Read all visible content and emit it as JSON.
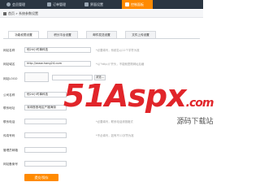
{
  "nav": [
    {
      "label": "会员管理",
      "icon": "user-icon",
      "active": false
    },
    {
      "label": "订单管理",
      "icon": "order-icon",
      "active": false
    },
    {
      "label": "界面设置",
      "icon": "appearance-icon",
      "active": false
    },
    {
      "label": "控制面板",
      "icon": "settings-icon",
      "active": true
    }
  ],
  "breadcrumb": {
    "home": "首页",
    "separator": "»",
    "current": "系统参数设置"
  },
  "tabs": [
    "功能权限设置",
    "积分平台设置",
    "邮件发送设置",
    "文件上传设置"
  ],
  "form": {
    "site_name_label": "网站名称",
    "site_name_value": "他24小时事科技",
    "site_name_hint": "*必要填写，系统名以11个字符为准",
    "site_domain_label": "网站域名",
    "site_domain_value": "http://www.hang24.com",
    "site_domain_hint": "*以\"http://\"开头，不能就是刚网址后缀",
    "logo_label": "网站LOGO",
    "logo_button": "浏览...",
    "company_label": "公司名称",
    "company_value": "他24小时事科技",
    "address_label": "联系地址",
    "address_value": "深圳首首地区产福海街",
    "phone_label": "联系电话",
    "phone_hint": "*必要填写，联系电话请按格式",
    "fax_label": "传真号码",
    "fax_hint": "*不必填写，如有不11字符为准",
    "admin_email_label": "管理员邮箱",
    "icp_label": "网站备案号"
  },
  "save_button": "提交/保存",
  "watermark": {
    "main": "51Aspx",
    "suffix": ".com",
    "sub": "源码下载站"
  },
  "colors": {
    "accent": "#ff8a00",
    "topbar": "#2b3642",
    "watermark": "#e1252a"
  }
}
